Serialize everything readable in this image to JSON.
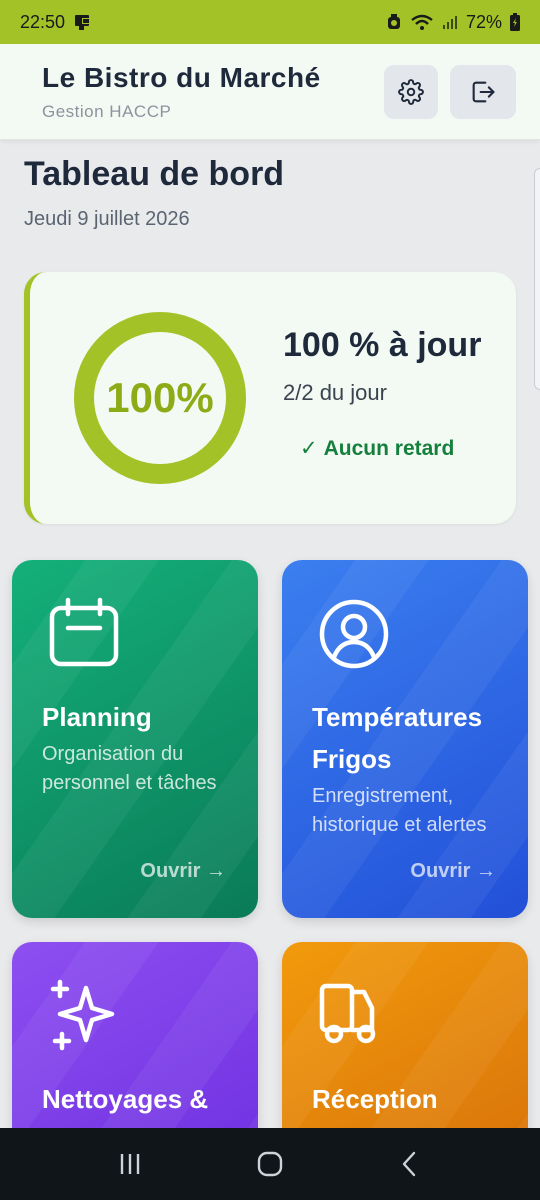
{
  "status_bar": {
    "time": "22:50",
    "battery": "72%"
  },
  "header": {
    "title": "Le Bistro du Marché",
    "subtitle": "Gestion HACCP",
    "settings_icon": "gear-icon",
    "logout_icon": "logout-icon"
  },
  "page": {
    "title": "Tableau de bord",
    "date": "Jeudi 9 juillet 2026"
  },
  "progress": {
    "value_percent": 100,
    "ring_label": "100%",
    "title": "100 % à jour",
    "count_text": "2/2 du jour",
    "status_check": "✓",
    "status_text": "Aucun retard",
    "ring_color": "#a3c227",
    "status_color": "#15803d"
  },
  "modules": [
    {
      "title": "Planning",
      "description": "Organisation du personnel et tâches",
      "open_label": "Ouvrir →",
      "icon": "calendar-icon",
      "color": "#10a673"
    },
    {
      "title": "Températures Frigos",
      "description": "Enregistrement, historique et alertes",
      "open_label": "Ouvrir →",
      "icon": "user-circle-icon",
      "color": "#2f6ee8"
    },
    {
      "title": "Nettoyages & Produits",
      "icon": "sparkles-icon",
      "color": "#7c3aed"
    },
    {
      "title": "Réception Marchandises",
      "icon": "truck-icon",
      "color": "#e68a0b"
    }
  ]
}
